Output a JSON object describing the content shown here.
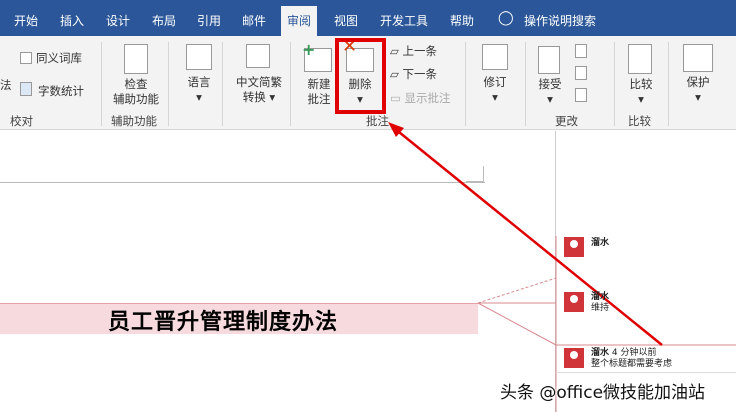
{
  "tabs": [
    "开始",
    "插入",
    "设计",
    "布局",
    "引用",
    "邮件",
    "审阅",
    "视图",
    "开发工具",
    "帮助"
  ],
  "active_tab": "审阅",
  "tell_me": "操作说明搜索",
  "ribbon": {
    "thesaurus": "同义词库",
    "grammar": "法",
    "word_count": "字数统计",
    "proofing_group": "校对",
    "check_access_1": "检查",
    "check_access_2": "辅助功能",
    "access_group": "辅助功能",
    "language": "语言",
    "chinese_1": "中文简繁",
    "chinese_2": "转换",
    "new_comment_1": "新建",
    "new_comment_2": "批注",
    "delete": "删除",
    "previous": "上一条",
    "next": "下一条",
    "show_comments": "显示批注",
    "comments_group": "批注",
    "track": "修订",
    "accept": "接受",
    "changes_group": "更改",
    "compare": "比较",
    "compare_group": "比较",
    "protect": "保护"
  },
  "document": {
    "title": "员工晋升管理制度办法"
  },
  "comments": [
    {
      "author": "溜水",
      "time": "",
      "text": ""
    },
    {
      "author": "溜水",
      "time": "",
      "text": "维持"
    },
    {
      "author": "溜水",
      "time": "4 分钟以前",
      "text": "整个标题都需要考虑"
    }
  ],
  "watermark": "头条 @office微技能加油站",
  "colors": {
    "tab_bar": "#2b579a",
    "highlight": "#e00000",
    "avatar": "#d13438"
  }
}
